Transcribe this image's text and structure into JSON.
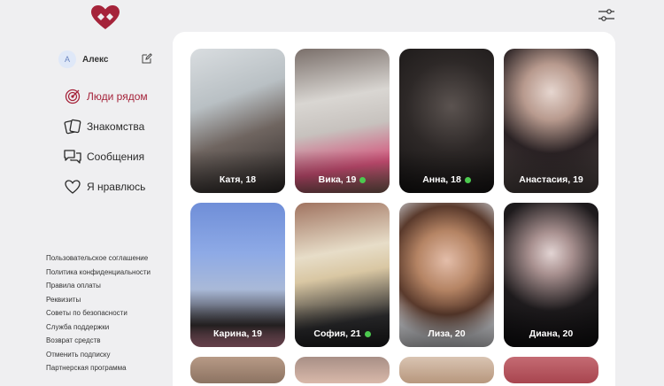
{
  "profile": {
    "initial": "А",
    "name": "Алекс"
  },
  "nav": [
    {
      "label": "Люди рядом",
      "icon": "target-icon",
      "active": true
    },
    {
      "label": "Знакомства",
      "icon": "cards-icon",
      "active": false
    },
    {
      "label": "Сообщения",
      "icon": "chat-icon",
      "active": false
    },
    {
      "label": "Я нравлюсь",
      "icon": "heart-icon",
      "active": false
    }
  ],
  "footer_links": [
    "Пользовательское соглашение",
    "Политика конфиденциальности",
    "Правила оплаты",
    "Реквизиты",
    "Советы по безопасности",
    "Служба поддержки",
    "Возврат средств",
    "Отменить подписку",
    "Партнерская программа"
  ],
  "profiles": [
    {
      "caption": "Катя, 18",
      "online": false
    },
    {
      "caption": "Вика, 19",
      "online": true
    },
    {
      "caption": "Анна, 18",
      "online": true
    },
    {
      "caption": "Анастасия, 19",
      "online": false
    },
    {
      "caption": "Карина, 19",
      "online": false
    },
    {
      "caption": "София, 21",
      "online": true
    },
    {
      "caption": "Лиза, 20",
      "online": false
    },
    {
      "caption": "Диана, 20",
      "online": false
    }
  ],
  "colors": {
    "accent": "#a5233a",
    "online": "#4cc94f",
    "background": "#efeff1"
  }
}
